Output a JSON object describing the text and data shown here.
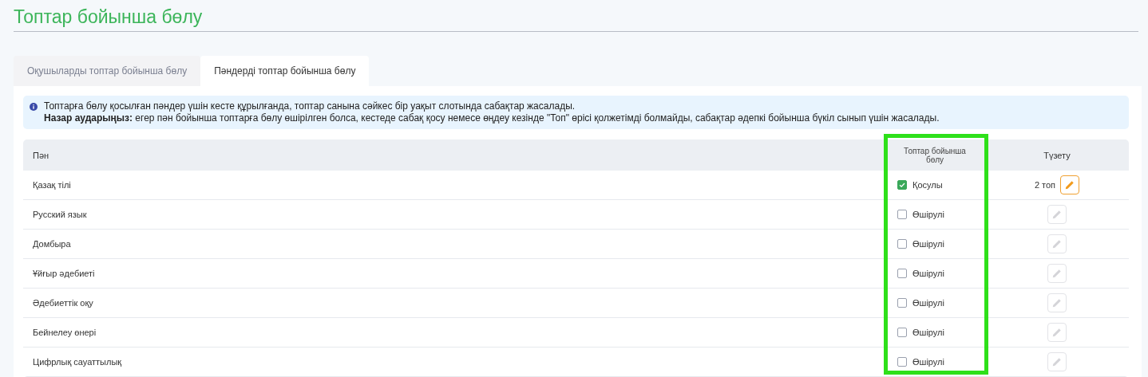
{
  "page_title": "Топтар бойынша бөлу",
  "tabs": [
    {
      "label": "Оқушыларды топтар бойынша бөлу",
      "selected": false
    },
    {
      "label": "Пәндерді топтар бойынша бөлу",
      "selected": true
    }
  ],
  "info": {
    "line_1": "Топтарға бөлу қосылған пәндер үшін кесте құрылғанда, топтар санына сәйкес бір уақыт слотында сабақтар жасалады.",
    "line_2": "**Назар аударыңыз:** егер пән бойынша топтарға бөлу өшірілген болса, кестеде сабақ қосу немесе өңдеу кезінде \"Топ\" өрісі қолжетімді болмайды, сабақтар әдепкі бойынша бүкіл сынып үшін жасалады."
  },
  "table": {
    "columns": [
      "Пән",
      "Топтар бойынша бөлу",
      "Түзету"
    ],
    "highlighted_column": true,
    "rows": [
      {
        "subject": "Қазақ тілі",
        "checked": true,
        "status": "Қосулы",
        "group_count": "2 топ",
        "edit_disabled": false
      },
      {
        "subject": "Русский язык",
        "checked": false,
        "status": "Өшірулі",
        "edit_disabled": true
      },
      {
        "subject": "Домбыра",
        "checked": false,
        "status": "Өшірулі",
        "edit_disabled": true
      },
      {
        "subject": "Ұйғыр әдебиеті",
        "checked": false,
        "status": "Өшірулі",
        "edit_disabled": true
      },
      {
        "subject": "Әдебиеттік оқу",
        "checked": false,
        "status": "Өшірулі",
        "edit_disabled": true
      },
      {
        "subject": "Бейнелеу өнері",
        "checked": false,
        "status": "Өшірулі",
        "edit_disabled": true
      },
      {
        "subject": "Цифрлық сауаттылық",
        "checked": false,
        "status": "Өшірулі",
        "edit_disabled": true
      }
    ]
  }
}
